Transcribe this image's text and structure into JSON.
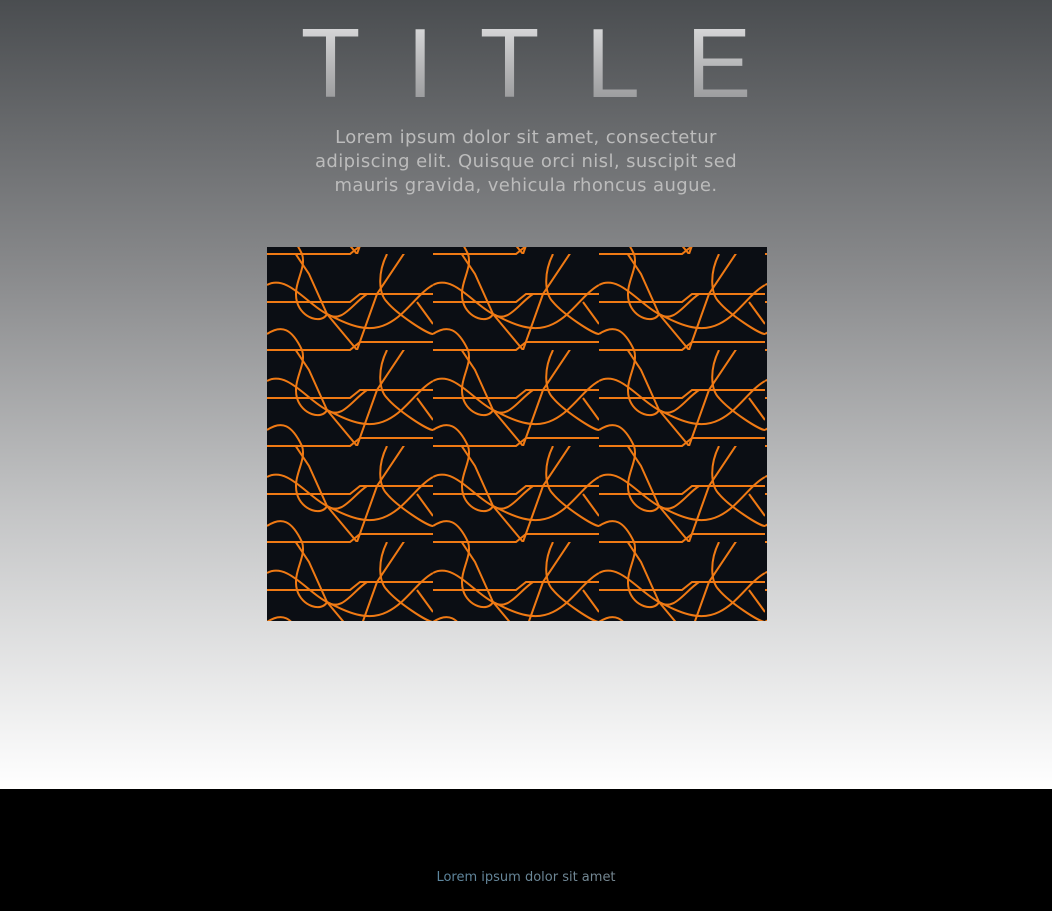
{
  "hero": {
    "title": "TITLE",
    "subtitle": "Lorem ipsum dolor sit amet, consectetur adipiscing elit. Quisque orci nisl, suscipit sed mauris gravida, vehicula rhoncus augue."
  },
  "pattern": {
    "background": "#0b0e14",
    "line_color": "#f07a14"
  },
  "footer": {
    "text": "Lorem ipsum dolor sit amet"
  }
}
